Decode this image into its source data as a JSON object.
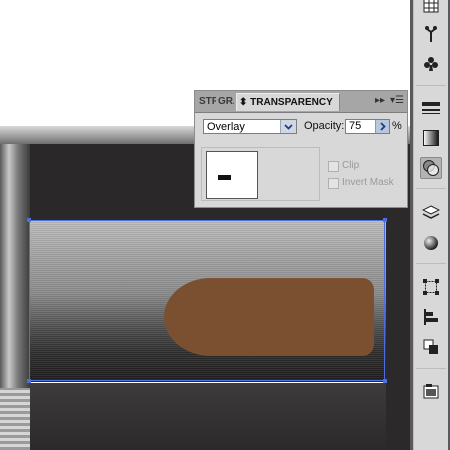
{
  "panel": {
    "tabs": [
      {
        "label": "STR"
      },
      {
        "label": "GRA"
      },
      {
        "label": "⬍ TRANSPARENCY"
      }
    ],
    "collapse_glyph": "▸▸",
    "menu_glyph": "▾☰",
    "blend_mode": "Overlay",
    "opacity_label": "Opacity:",
    "opacity_value": "75",
    "opacity_unit": "%",
    "clip_label": "Clip",
    "invert_mask_label": "Invert Mask",
    "clip_checked": false,
    "invert_mask_checked": false
  },
  "artwork": {
    "cap_color": "#7a5030",
    "selection_color": "#4c6fe0"
  },
  "toolbar": {
    "tools": [
      {
        "icon": "grid-icon"
      },
      {
        "icon": "symbol-sprayer-icon"
      },
      {
        "icon": "club-icon"
      },
      {
        "icon": "stroke-icon"
      },
      {
        "icon": "gradient-icon"
      },
      {
        "icon": "transparency-icon",
        "active": true
      },
      {
        "icon": "appearance-icon"
      },
      {
        "icon": "graphic-styles-icon"
      },
      {
        "icon": "transform-icon"
      },
      {
        "icon": "align-icon"
      },
      {
        "icon": "pathfinder-icon"
      },
      {
        "icon": "layers-icon"
      }
    ]
  }
}
